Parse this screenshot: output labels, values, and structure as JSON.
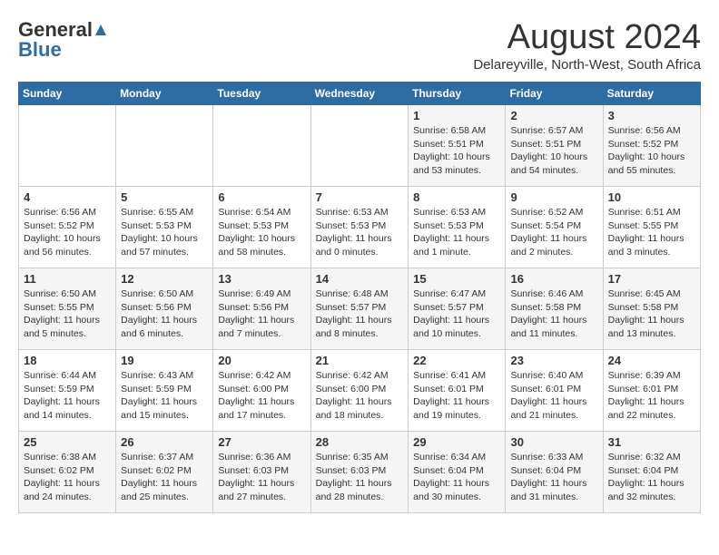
{
  "header": {
    "logo_general": "General",
    "logo_blue": "Blue",
    "month_year": "August 2024",
    "location": "Delareyville, North-West, South Africa"
  },
  "days_of_week": [
    "Sunday",
    "Monday",
    "Tuesday",
    "Wednesday",
    "Thursday",
    "Friday",
    "Saturday"
  ],
  "weeks": [
    [
      {
        "day": "",
        "info": ""
      },
      {
        "day": "",
        "info": ""
      },
      {
        "day": "",
        "info": ""
      },
      {
        "day": "",
        "info": ""
      },
      {
        "day": "1",
        "info": "Sunrise: 6:58 AM\nSunset: 5:51 PM\nDaylight: 10 hours and 53 minutes."
      },
      {
        "day": "2",
        "info": "Sunrise: 6:57 AM\nSunset: 5:51 PM\nDaylight: 10 hours and 54 minutes."
      },
      {
        "day": "3",
        "info": "Sunrise: 6:56 AM\nSunset: 5:52 PM\nDaylight: 10 hours and 55 minutes."
      }
    ],
    [
      {
        "day": "4",
        "info": "Sunrise: 6:56 AM\nSunset: 5:52 PM\nDaylight: 10 hours and 56 minutes."
      },
      {
        "day": "5",
        "info": "Sunrise: 6:55 AM\nSunset: 5:53 PM\nDaylight: 10 hours and 57 minutes."
      },
      {
        "day": "6",
        "info": "Sunrise: 6:54 AM\nSunset: 5:53 PM\nDaylight: 10 hours and 58 minutes."
      },
      {
        "day": "7",
        "info": "Sunrise: 6:53 AM\nSunset: 5:53 PM\nDaylight: 11 hours and 0 minutes."
      },
      {
        "day": "8",
        "info": "Sunrise: 6:53 AM\nSunset: 5:53 PM\nDaylight: 11 hours and 1 minute."
      },
      {
        "day": "9",
        "info": "Sunrise: 6:52 AM\nSunset: 5:54 PM\nDaylight: 11 hours and 2 minutes."
      },
      {
        "day": "10",
        "info": "Sunrise: 6:51 AM\nSunset: 5:55 PM\nDaylight: 11 hours and 3 minutes."
      }
    ],
    [
      {
        "day": "11",
        "info": "Sunrise: 6:50 AM\nSunset: 5:55 PM\nDaylight: 11 hours and 5 minutes."
      },
      {
        "day": "12",
        "info": "Sunrise: 6:50 AM\nSunset: 5:56 PM\nDaylight: 11 hours and 6 minutes."
      },
      {
        "day": "13",
        "info": "Sunrise: 6:49 AM\nSunset: 5:56 PM\nDaylight: 11 hours and 7 minutes."
      },
      {
        "day": "14",
        "info": "Sunrise: 6:48 AM\nSunset: 5:57 PM\nDaylight: 11 hours and 8 minutes."
      },
      {
        "day": "15",
        "info": "Sunrise: 6:47 AM\nSunset: 5:57 PM\nDaylight: 11 hours and 10 minutes."
      },
      {
        "day": "16",
        "info": "Sunrise: 6:46 AM\nSunset: 5:58 PM\nDaylight: 11 hours and 11 minutes."
      },
      {
        "day": "17",
        "info": "Sunrise: 6:45 AM\nSunset: 5:58 PM\nDaylight: 11 hours and 13 minutes."
      }
    ],
    [
      {
        "day": "18",
        "info": "Sunrise: 6:44 AM\nSunset: 5:59 PM\nDaylight: 11 hours and 14 minutes."
      },
      {
        "day": "19",
        "info": "Sunrise: 6:43 AM\nSunset: 5:59 PM\nDaylight: 11 hours and 15 minutes."
      },
      {
        "day": "20",
        "info": "Sunrise: 6:42 AM\nSunset: 6:00 PM\nDaylight: 11 hours and 17 minutes."
      },
      {
        "day": "21",
        "info": "Sunrise: 6:42 AM\nSunset: 6:00 PM\nDaylight: 11 hours and 18 minutes."
      },
      {
        "day": "22",
        "info": "Sunrise: 6:41 AM\nSunset: 6:01 PM\nDaylight: 11 hours and 19 minutes."
      },
      {
        "day": "23",
        "info": "Sunrise: 6:40 AM\nSunset: 6:01 PM\nDaylight: 11 hours and 21 minutes."
      },
      {
        "day": "24",
        "info": "Sunrise: 6:39 AM\nSunset: 6:01 PM\nDaylight: 11 hours and 22 minutes."
      }
    ],
    [
      {
        "day": "25",
        "info": "Sunrise: 6:38 AM\nSunset: 6:02 PM\nDaylight: 11 hours and 24 minutes."
      },
      {
        "day": "26",
        "info": "Sunrise: 6:37 AM\nSunset: 6:02 PM\nDaylight: 11 hours and 25 minutes."
      },
      {
        "day": "27",
        "info": "Sunrise: 6:36 AM\nSunset: 6:03 PM\nDaylight: 11 hours and 27 minutes."
      },
      {
        "day": "28",
        "info": "Sunrise: 6:35 AM\nSunset: 6:03 PM\nDaylight: 11 hours and 28 minutes."
      },
      {
        "day": "29",
        "info": "Sunrise: 6:34 AM\nSunset: 6:04 PM\nDaylight: 11 hours and 30 minutes."
      },
      {
        "day": "30",
        "info": "Sunrise: 6:33 AM\nSunset: 6:04 PM\nDaylight: 11 hours and 31 minutes."
      },
      {
        "day": "31",
        "info": "Sunrise: 6:32 AM\nSunset: 6:04 PM\nDaylight: 11 hours and 32 minutes."
      }
    ]
  ]
}
